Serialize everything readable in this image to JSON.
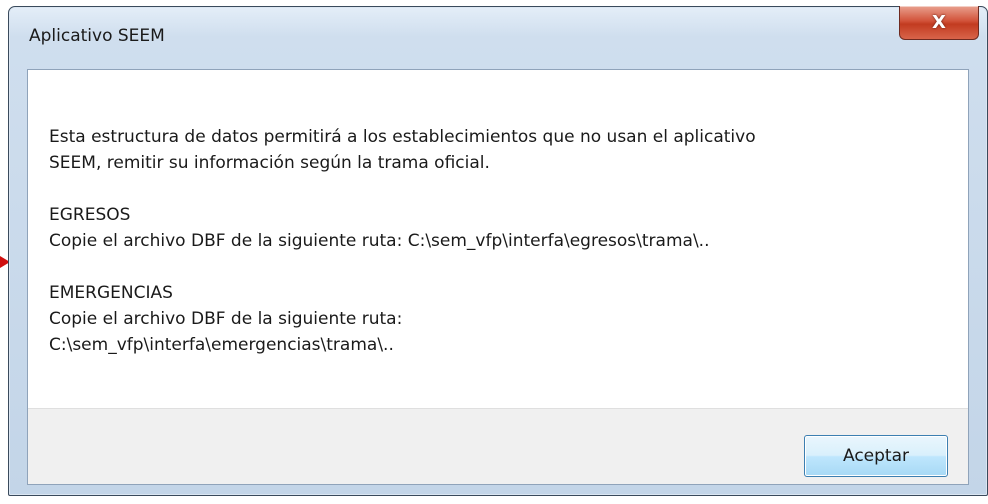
{
  "window": {
    "title": "Aplicativo SEEM",
    "close_glyph": "X"
  },
  "message": {
    "intro_line1": "Esta estructura de datos permitirá a los establecimientos que no usan el aplicativo",
    "intro_line2": "SEEM, remitir su información según la trama oficial.",
    "egresos_heading": "EGRESOS",
    "egresos_text": "Copie el archivo DBF de la siguiente ruta: C:\\sem_vfp\\interfa\\egresos\\trama\\..",
    "emergencias_heading": "EMERGENCIAS",
    "emergencias_text": "Copie el archivo DBF de la siguiente ruta:",
    "emergencias_path": "C:\\sem_vfp\\interfa\\emergencias\\trama\\.."
  },
  "buttons": {
    "accept_label": "Aceptar"
  },
  "colors": {
    "close_button": "#c23b20",
    "accept_border": "#3c7fb1",
    "annotation_arrow": "#d01010"
  },
  "icons": {
    "close": "close-icon",
    "annotation": "red-arrow-marker"
  }
}
